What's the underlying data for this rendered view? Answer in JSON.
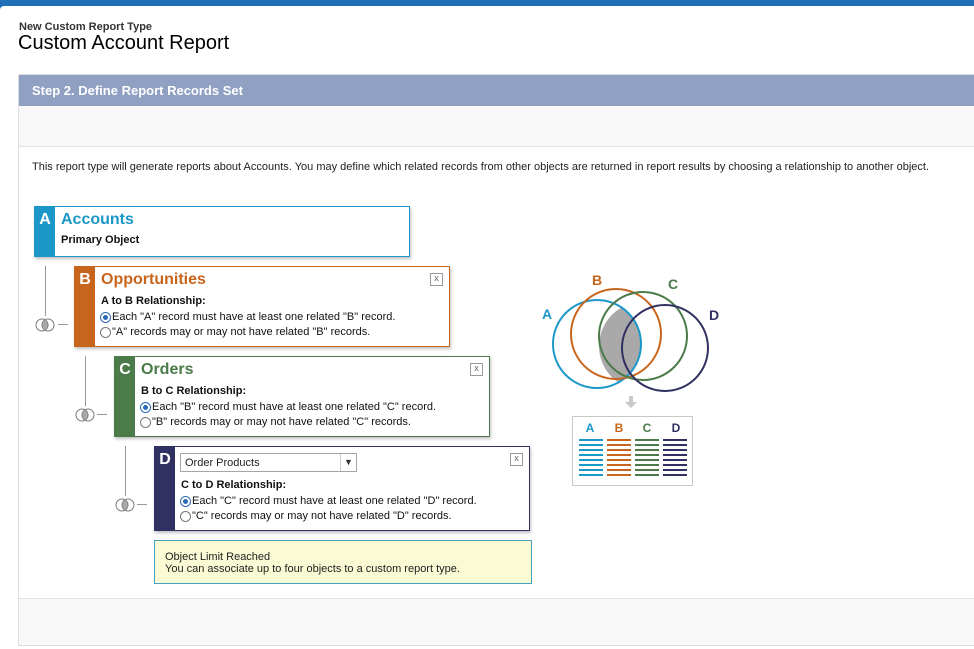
{
  "header": {
    "subtitle": "New Custom Report Type",
    "title": "Custom Account Report"
  },
  "step": {
    "label": "Step 2. Define Report Records Set"
  },
  "intro_text": "This report type will generate reports about Accounts. You may define which related records from other objects are returned in report results by choosing a relationship to another object.",
  "objects": {
    "a": {
      "letter": "A",
      "name": "Accounts",
      "sub": "Primary Object",
      "color": "#1b97c8"
    },
    "b": {
      "letter": "B",
      "name": "Opportunities",
      "rel_label": "A to B Relationship:",
      "opt1": "Each \"A\" record must have at least one related \"B\" record.",
      "opt2": "\"A\" records may or may not have related \"B\" records.",
      "selected": "opt1",
      "color": "#c8651c"
    },
    "c": {
      "letter": "C",
      "name": "Orders",
      "rel_label": "B to C Relationship:",
      "opt1": "Each \"B\" record must have at least one related \"C\" record.",
      "opt2": "\"B\" records may or may not have related \"C\" records.",
      "selected": "opt1",
      "color": "#4b7b49"
    },
    "d": {
      "letter": "D",
      "select_value": "Order Products",
      "rel_label": "C to D Relationship:",
      "opt1": "Each \"C\" record must have at least one related \"D\" record.",
      "opt2": "\"C\" records may or may not have related \"D\" records.",
      "selected": "opt1",
      "color": "#313062"
    }
  },
  "close_label": "x",
  "notice": {
    "title": "Object Limit Reached",
    "text": "You can associate up to four objects to a custom report type."
  },
  "venn": {
    "labels": [
      "A",
      "B",
      "C",
      "D"
    ],
    "colors": [
      "#1b97c8",
      "#c8651c",
      "#4b7b49",
      "#313062"
    ]
  },
  "legend": {
    "letters": [
      "A",
      "B",
      "C",
      "D"
    ]
  },
  "icons": [
    "join-icon",
    "close-icon",
    "dropdown-arrow-icon",
    "down-arrow-icon"
  ]
}
